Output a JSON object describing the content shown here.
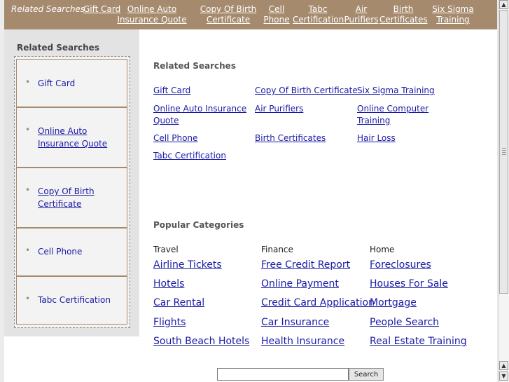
{
  "topbar": {
    "title": "Related Searches",
    "links": [
      "Gift Card",
      "Online Auto Insurance Quote",
      "Copy Of Birth Certificate",
      "Cell Phone",
      "Tabc Certification",
      "Air Purifiers",
      "Birth Certificates",
      "Six Sigma Training"
    ]
  },
  "sidebar": {
    "title": "Related Searches",
    "items": [
      "Gift Card",
      "Online Auto Insurance Quote",
      "Copy Of Birth Certificate",
      "Cell Phone",
      "Tabc Certification"
    ]
  },
  "related": {
    "title": "Related Searches",
    "links": [
      "Gift Card",
      "Copy Of Birth Certificate",
      "Six Sigma Training",
      "Online Auto Insurance Quote",
      "Air Purifiers",
      "Online Computer Training",
      "Cell Phone",
      "Birth Certificates",
      "Hair Loss",
      "Tabc Certification"
    ]
  },
  "popular": {
    "title": "Popular Categories",
    "columns": [
      {
        "heading": "Travel",
        "links": [
          "Airline Tickets",
          "Hotels",
          "Car Rental",
          "Flights",
          "South Beach Hotels"
        ]
      },
      {
        "heading": "Finance",
        "links": [
          "Free Credit Report",
          "Online Payment",
          "Credit Card Application",
          "Car Insurance",
          "Health Insurance"
        ]
      },
      {
        "heading": "Home",
        "links": [
          "Foreclosures",
          "Houses For Sale",
          "Mortgage",
          "People Search",
          "Real Estate Training"
        ]
      }
    ]
  },
  "search": {
    "value": "",
    "button": "Search"
  },
  "colors": {
    "topbar": "#a58a6d",
    "link": "#1a1aa6",
    "sidebar_bg": "#e3e3e3"
  },
  "icons": {
    "scroll_up": "scroll-up-arrow-icon",
    "scroll_down": "scroll-down-arrow-icon",
    "bullet": "bullet-icon"
  }
}
